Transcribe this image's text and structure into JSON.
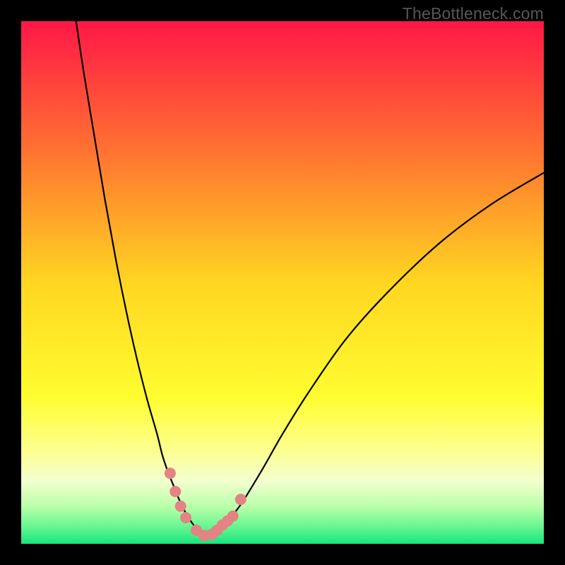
{
  "watermark": "TheBottleneck.com",
  "colors": {
    "black": "#000000",
    "curve": "#000000",
    "marker": "#e38383"
  },
  "chart_data": {
    "type": "line",
    "title": "",
    "xlabel": "",
    "ylabel": "",
    "xlim": [
      0,
      100
    ],
    "ylim": [
      0,
      100
    ],
    "grid": false,
    "background_gradient": {
      "stops": [
        {
          "offset": 0.0,
          "color": "#ff1747"
        },
        {
          "offset": 0.25,
          "color": "#ff7331"
        },
        {
          "offset": 0.5,
          "color": "#ffd621"
        },
        {
          "offset": 0.72,
          "color": "#fffd30"
        },
        {
          "offset": 0.82,
          "color": "#fcff8e"
        },
        {
          "offset": 0.88,
          "color": "#f3ffcf"
        },
        {
          "offset": 0.93,
          "color": "#b7ffa8"
        },
        {
          "offset": 0.97,
          "color": "#60f58f"
        },
        {
          "offset": 1.0,
          "color": "#18e57e"
        }
      ]
    },
    "series": [
      {
        "name": "left-branch",
        "x": [
          10.5,
          12,
          14,
          16,
          18,
          20,
          22,
          24,
          26,
          27,
          28,
          29,
          30,
          31,
          32,
          33,
          34,
          35
        ],
        "y": [
          100,
          90,
          78,
          66,
          55,
          45,
          36,
          28,
          21,
          17,
          14,
          11.5,
          9,
          6.8,
          5,
          3.6,
          2.4,
          1.5
        ]
      },
      {
        "name": "right-branch",
        "x": [
          35,
          37,
          39,
          42,
          46,
          50,
          55,
          62,
          70,
          80,
          90,
          100
        ],
        "y": [
          1.5,
          2.0,
          3.8,
          7.5,
          14,
          21,
          29,
          39,
          48,
          57.5,
          65,
          71
        ]
      }
    ],
    "markers": {
      "color": "#e38383",
      "radius_px": 8,
      "points": [
        {
          "x": 28.5,
          "y": 13.5
        },
        {
          "x": 29.5,
          "y": 10
        },
        {
          "x": 30.5,
          "y": 7.2
        },
        {
          "x": 31.5,
          "y": 5
        },
        {
          "x": 33.5,
          "y": 2.6
        },
        {
          "x": 35.0,
          "y": 1.6
        },
        {
          "x": 36.5,
          "y": 1.8
        },
        {
          "x": 37.5,
          "y": 2.6
        },
        {
          "x": 38.5,
          "y": 3.6
        },
        {
          "x": 39.5,
          "y": 4.4
        },
        {
          "x": 40.5,
          "y": 5.3
        },
        {
          "x": 42.0,
          "y": 8.5
        }
      ]
    }
  }
}
